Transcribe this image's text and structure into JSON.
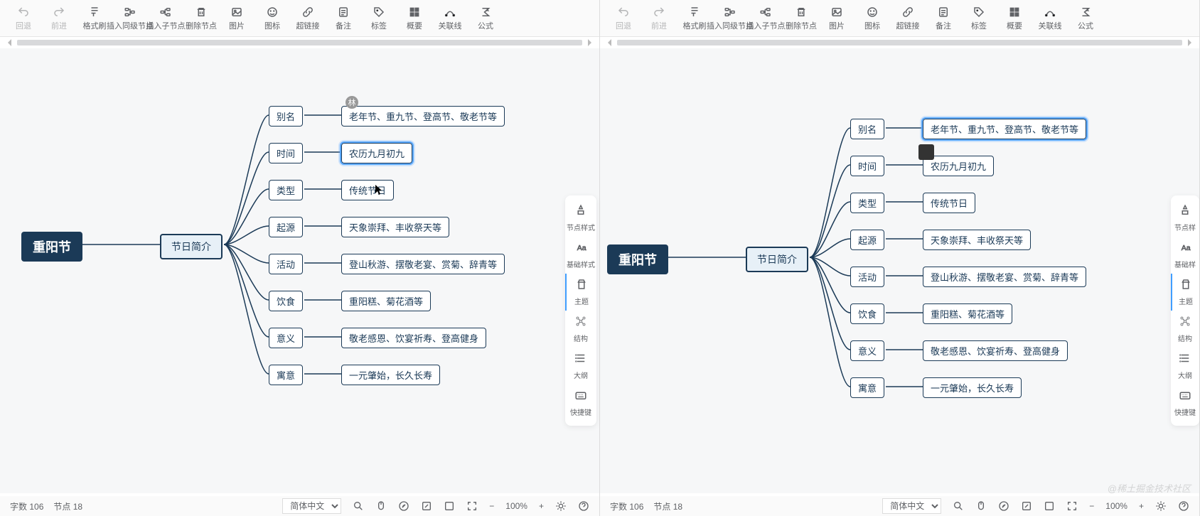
{
  "toolbar": [
    {
      "key": "undo",
      "label": "回退",
      "disabled": true
    },
    {
      "key": "redo",
      "label": "前进",
      "disabled": true
    },
    {
      "key": "format",
      "label": "格式刷"
    },
    {
      "key": "sibling",
      "label": "插入同级节点"
    },
    {
      "key": "child",
      "label": "插入子节点"
    },
    {
      "key": "delnode",
      "label": "删除节点"
    },
    {
      "key": "image",
      "label": "图片"
    },
    {
      "key": "icon",
      "label": "图标"
    },
    {
      "key": "link",
      "label": "超链接"
    },
    {
      "key": "note",
      "label": "备注"
    },
    {
      "key": "tag",
      "label": "标签"
    },
    {
      "key": "summary",
      "label": "概要"
    },
    {
      "key": "assoc",
      "label": "关联线"
    },
    {
      "key": "formula",
      "label": "公式"
    }
  ],
  "palette": [
    {
      "key": "nodestyle",
      "label": "节点样式"
    },
    {
      "key": "basestyle",
      "label": "基础样式"
    },
    {
      "key": "theme",
      "label": "主题",
      "active": true
    },
    {
      "key": "structure",
      "label": "结构"
    },
    {
      "key": "outline",
      "label": "大纲"
    },
    {
      "key": "shortcut",
      "label": "快捷键"
    }
  ],
  "palette_r": [
    {
      "key": "nodestyle",
      "label": "节点样"
    },
    {
      "key": "basestyle",
      "label": "基础样"
    },
    {
      "key": "theme",
      "label": "主题",
      "active": true
    },
    {
      "key": "structure",
      "label": "结构"
    },
    {
      "key": "outline",
      "label": "大纲"
    },
    {
      "key": "shortcut",
      "label": "快捷键"
    }
  ],
  "mindmap": {
    "root": "重阳节",
    "mid": "节日简介",
    "avatar_badge": "林",
    "branches": [
      {
        "cat": "别名",
        "val": "老年节、重九节、登高节、敬老节等"
      },
      {
        "cat": "时间",
        "val": "农历九月初九"
      },
      {
        "cat": "类型",
        "val": "传统节日"
      },
      {
        "cat": "起源",
        "val": "天象崇拜、丰收祭天等"
      },
      {
        "cat": "活动",
        "val": "登山秋游、摆敬老宴、赏菊、辞青等"
      },
      {
        "cat": "饮食",
        "val": "重阳糕、菊花酒等"
      },
      {
        "cat": "意义",
        "val": "敬老感恩、饮宴祈寿、登高健身"
      },
      {
        "cat": "寓意",
        "val": "一元肇始，长久长寿"
      }
    ],
    "cursor_selected_text": "传统节日"
  },
  "status": {
    "wordcount_label": "字数",
    "wordcount": "106",
    "nodecount_label": "节点",
    "nodecount": "18",
    "lang": "简体中文",
    "zoom": "100%"
  },
  "watermark": "@稀土掘金技术社区"
}
